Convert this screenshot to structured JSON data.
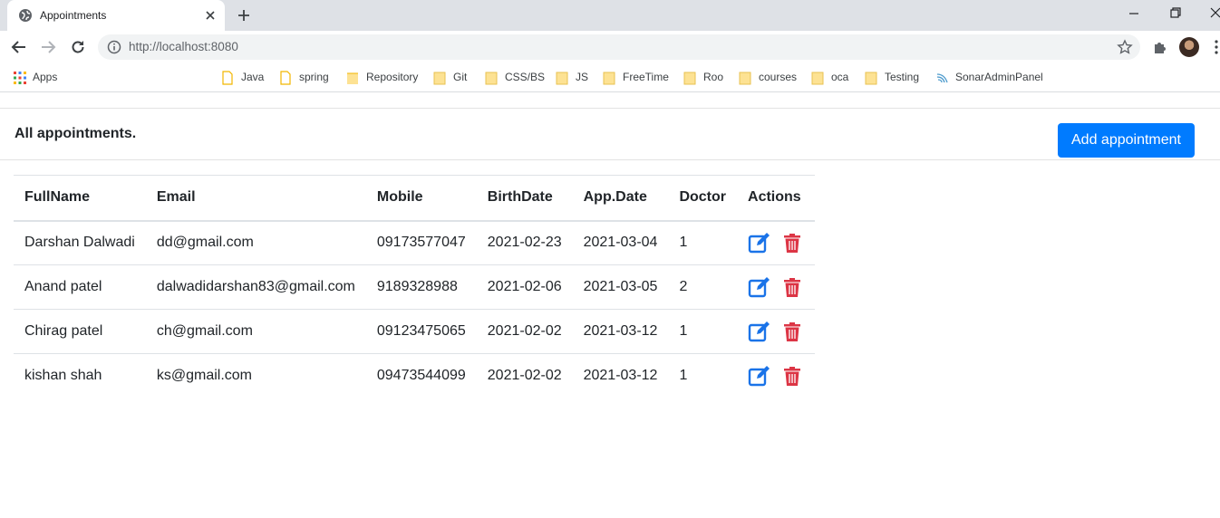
{
  "browser": {
    "tab_title": "Appointments",
    "url": "http://localhost:8080",
    "apps_label": "Apps",
    "bookmarks": [
      "Java",
      "spring",
      "Repository",
      "Git",
      "CSS/BS",
      "JS",
      "FreeTime",
      "Roo",
      "courses",
      "oca",
      "Testing",
      "SonarAdminPanel"
    ]
  },
  "page": {
    "title": "All appointments.",
    "add_button_label": "Add appointment"
  },
  "table": {
    "headers": [
      "FullName",
      "Email",
      "Mobile",
      "BirthDate",
      "App.Date",
      "Doctor",
      "Actions"
    ],
    "rows": [
      [
        "Darshan Dalwadi",
        "dd@gmail.com",
        "09173577047",
        "2021-02-23",
        "2021-03-04",
        "1"
      ],
      [
        "Anand patel",
        "dalwadidarshan83@gmail.com",
        "9189328988",
        "2021-02-06",
        "2021-03-05",
        "2"
      ],
      [
        "Chirag patel",
        "ch@gmail.com",
        "09123475065",
        "2021-02-02",
        "2021-03-12",
        "1"
      ],
      [
        "kishan shah",
        "ks@gmail.com",
        "09473544099",
        "2021-02-02",
        "2021-03-12",
        "1"
      ]
    ]
  },
  "colors": {
    "primary": "#007bff",
    "edit_icon": "#1a73e8",
    "delete_icon": "#dc3545"
  },
  "icons": {
    "edit": "edit-icon",
    "delete": "trash-icon"
  }
}
